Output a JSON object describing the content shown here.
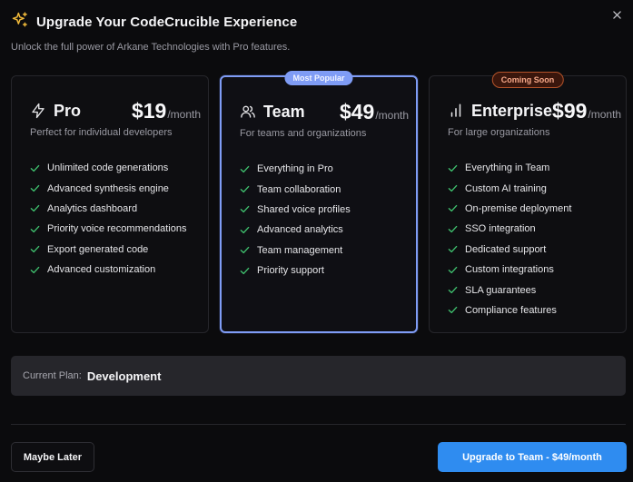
{
  "dialog": {
    "title": "Upgrade Your CodeCrucible Experience",
    "subtitle": "Unlock the full power of Arkane Technologies with Pro features."
  },
  "colors": {
    "accent": "#7f9cf5",
    "primary_button": "#2f8cf0",
    "check": "#3fbf6e",
    "title_icon": "#f0b93a",
    "coming_soon": "#f7a98a"
  },
  "plans": [
    {
      "name": "Pro",
      "icon": "lightning-icon",
      "price": "$19",
      "unit": "/month",
      "description": "Perfect for individual developers",
      "features": [
        "Unlimited code generations",
        "Advanced synthesis engine",
        "Analytics dashboard",
        "Priority voice recommendations",
        "Export generated code",
        "Advanced customization"
      ]
    },
    {
      "name": "Team",
      "icon": "users-icon",
      "badge": "Most Popular",
      "price": "$49",
      "unit": "/month",
      "description": "For teams and organizations",
      "features": [
        "Everything in Pro",
        "Team collaboration",
        "Shared voice profiles",
        "Advanced analytics",
        "Team management",
        "Priority support"
      ]
    },
    {
      "name": "Enterprise",
      "icon": "bar-chart-icon",
      "badge": "Coming Soon",
      "price": "$99",
      "unit": "/month",
      "description": "For large organizations",
      "features": [
        "Everything in Team",
        "Custom AI training",
        "On-premise deployment",
        "SSO integration",
        "Dedicated support",
        "Custom integrations",
        "SLA guarantees",
        "Compliance features"
      ]
    }
  ],
  "current_plan": {
    "label": "Current Plan:",
    "value": "Development"
  },
  "actions": {
    "later_label": "Maybe Later",
    "upgrade_label": "Upgrade to Team - $49/month"
  }
}
